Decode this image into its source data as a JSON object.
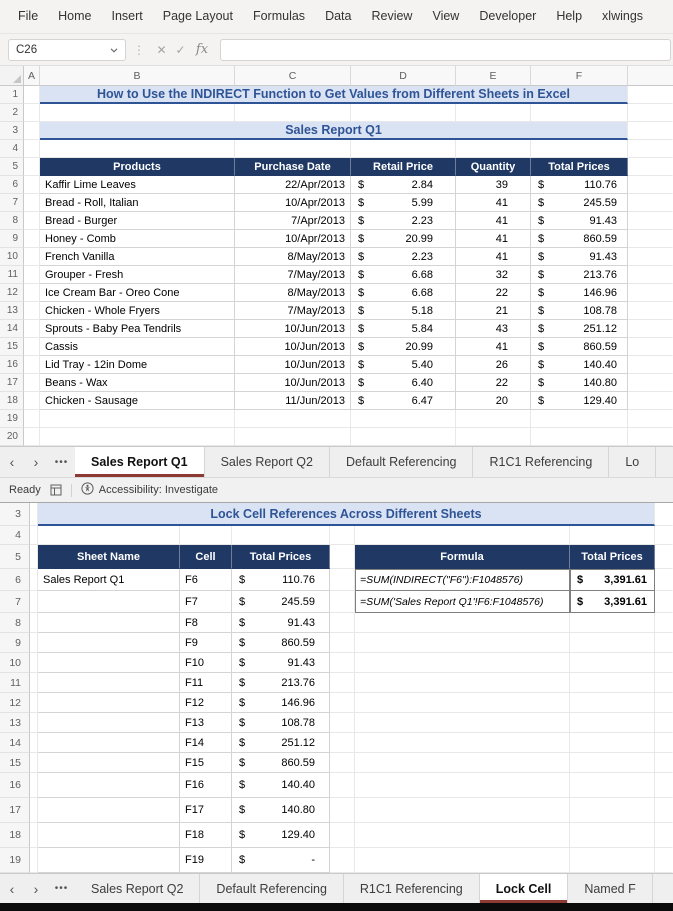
{
  "currency": "$",
  "colors": {
    "tab_accent": "#8E3A34",
    "header_navy": "#1F3864",
    "title_blue": "#2F5496",
    "band_lavender": "#DAE3F3"
  },
  "icons": {
    "cancel": "✕",
    "enter": "✓",
    "fx": "fx",
    "menu_dots": "⋮",
    "nav_left": "‹",
    "nav_right": "›",
    "tab_ellipsis": "•••"
  },
  "ribbon": {
    "tabs": [
      "File",
      "Home",
      "Insert",
      "Page Layout",
      "Formulas",
      "Data",
      "Review",
      "View",
      "Developer",
      "Help",
      "xlwings"
    ]
  },
  "formula_bar": {
    "name_box": "C26",
    "value": ""
  },
  "top_sheet": {
    "column_headers": [
      "A",
      "B",
      "C",
      "D",
      "E",
      "F"
    ],
    "row_numbers": [
      1,
      2,
      3,
      4,
      5,
      6,
      7,
      8,
      9,
      10,
      11,
      12,
      13,
      14,
      15,
      16,
      17,
      18,
      19,
      20
    ],
    "doc_title": "How to Use the INDIRECT Function to Get Values from Different Sheets in Excel",
    "section_title": "Sales Report Q1",
    "table": {
      "headers": [
        "Products",
        "Purchase Date",
        "Retail Price",
        "Quantity",
        "Total Prices"
      ],
      "rows": [
        [
          "Kaffir Lime Leaves",
          "22/Apr/2013",
          "2.84",
          "39",
          "110.76"
        ],
        [
          "Bread - Roll, Italian",
          "10/Apr/2013",
          "5.99",
          "41",
          "245.59"
        ],
        [
          "Bread - Burger",
          "7/Apr/2013",
          "2.23",
          "41",
          "91.43"
        ],
        [
          "Honey - Comb",
          "10/Apr/2013",
          "20.99",
          "41",
          "860.59"
        ],
        [
          "French Vanilla",
          "8/May/2013",
          "2.23",
          "41",
          "91.43"
        ],
        [
          "Grouper - Fresh",
          "7/May/2013",
          "6.68",
          "32",
          "213.76"
        ],
        [
          "Ice Cream Bar - Oreo Cone",
          "8/May/2013",
          "6.68",
          "22",
          "146.96"
        ],
        [
          "Chicken - Whole Fryers",
          "7/May/2013",
          "5.18",
          "21",
          "108.78"
        ],
        [
          "Sprouts - Baby Pea Tendrils",
          "10/Jun/2013",
          "5.84",
          "43",
          "251.12"
        ],
        [
          "Cassis",
          "10/Jun/2013",
          "20.99",
          "41",
          "860.59"
        ],
        [
          "Lid Tray - 12in Dome",
          "10/Jun/2013",
          "5.40",
          "26",
          "140.40"
        ],
        [
          "Beans - Wax",
          "10/Jun/2013",
          "6.40",
          "22",
          "140.80"
        ],
        [
          "Chicken - Sausage",
          "11/Jun/2013",
          "6.47",
          "20",
          "129.40"
        ]
      ]
    },
    "tabs": {
      "items": [
        "Sales Report Q1",
        "Sales Report Q2",
        "Default Referencing",
        "R1C1 Referencing",
        "Lo"
      ],
      "active_index": 0
    },
    "status": {
      "mode": "Ready",
      "accessibility": "Accessibility: Investigate"
    }
  },
  "bottom_sheet": {
    "row_numbers": [
      3,
      4,
      5,
      6,
      7,
      8,
      9,
      10,
      11,
      12,
      13,
      14,
      15,
      16,
      17,
      18,
      19
    ],
    "doc_title": "Lock Cell References Across Different Sheets",
    "ref_table": {
      "headers": [
        "Sheet Name",
        "Cell",
        "Total Prices"
      ],
      "sheet_name": "Sales Report Q1",
      "rows": [
        [
          "F6",
          "110.76"
        ],
        [
          "F7",
          "245.59"
        ],
        [
          "F8",
          "91.43"
        ],
        [
          "F9",
          "860.59"
        ],
        [
          "F10",
          "91.43"
        ],
        [
          "F11",
          "213.76"
        ],
        [
          "F12",
          "146.96"
        ],
        [
          "F13",
          "108.78"
        ],
        [
          "F14",
          "251.12"
        ],
        [
          "F15",
          "860.59"
        ],
        [
          "F16",
          "140.40"
        ],
        [
          "F17",
          "140.80"
        ],
        [
          "F18",
          "129.40"
        ],
        [
          "F19",
          "-"
        ]
      ]
    },
    "formula_table": {
      "headers": [
        "Formula",
        "Total Prices"
      ],
      "rows": [
        [
          "=SUM(INDIRECT(\"F6\"):F1048576)",
          "3,391.61"
        ],
        [
          "=SUM('Sales Report Q1'!F6:F1048576)",
          "3,391.61"
        ]
      ]
    },
    "tabs": {
      "items": [
        "Sales Report Q2",
        "Default Referencing",
        "R1C1 Referencing",
        "Lock Cell",
        "Named F"
      ],
      "active_index": 3
    }
  }
}
